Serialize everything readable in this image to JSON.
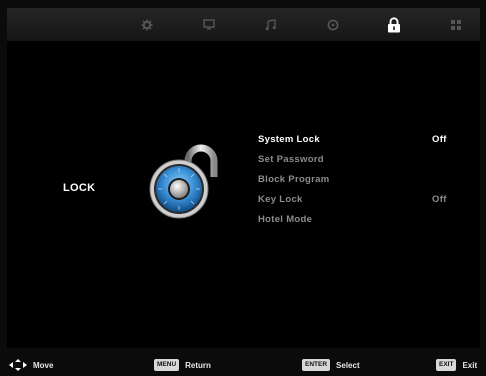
{
  "topbar": {
    "tabs": [
      {
        "icon": "gear-icon"
      },
      {
        "icon": "monitor-icon"
      },
      {
        "icon": "music-note-icon"
      },
      {
        "icon": "clock-icon"
      },
      {
        "icon": "lock-icon",
        "selected": true
      },
      {
        "icon": "grid-icon"
      }
    ]
  },
  "page": {
    "title": "LOCK"
  },
  "menu": {
    "items": [
      {
        "label": "System Lock",
        "value": "Off"
      },
      {
        "label": "Set Password",
        "value": ""
      },
      {
        "label": "Block Program",
        "value": ""
      },
      {
        "label": "Key Lock",
        "value": "Off"
      },
      {
        "label": "Hotel Mode",
        "value": ""
      }
    ]
  },
  "bottombar": {
    "move": {
      "label": "Move"
    },
    "return": {
      "key": "MENU",
      "label": "Return"
    },
    "select": {
      "key": "ENTER",
      "label": "Select"
    },
    "exit": {
      "key": "EXIT",
      "label": "Exit"
    }
  },
  "colors": {
    "active_text": "#ffffff",
    "inactive_text": "#8c8c8c",
    "lock_dial": "#3a8fd6"
  }
}
